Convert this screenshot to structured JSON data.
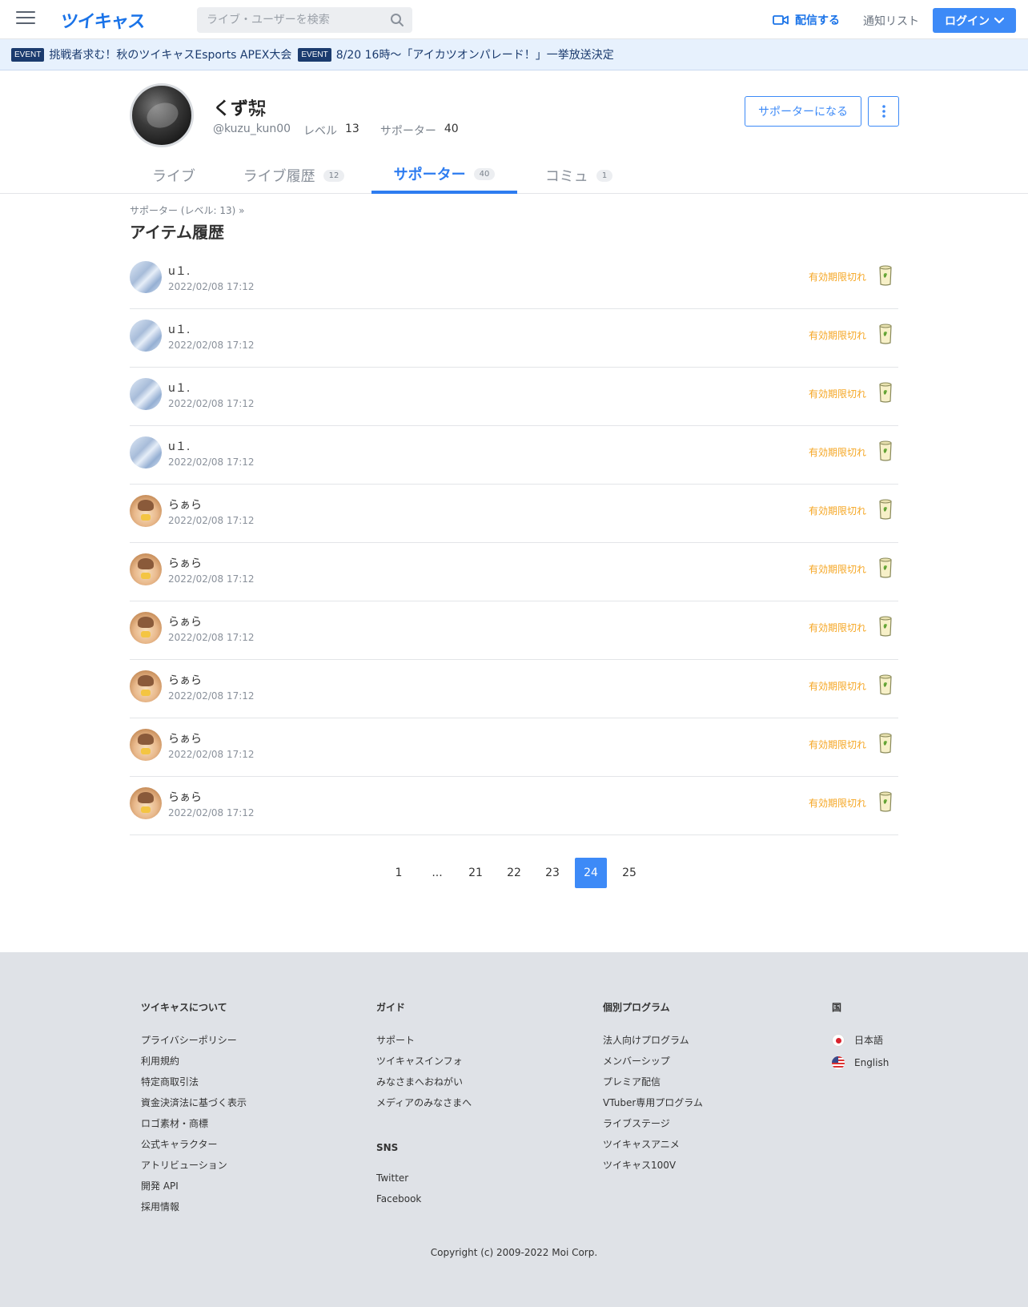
{
  "header": {
    "logo": "ツイキャス",
    "search_placeholder": "ライブ・ユーザーを検索",
    "stream_label": "配信する",
    "notify_label": "通知リスト",
    "login_label": "ログイン"
  },
  "events": [
    {
      "badge": "EVENT",
      "text": "挑戦者求む！秋のツイキャスEsports APEX大会"
    },
    {
      "badge": "EVENT",
      "text": "8/20 16時〜「アイカツオンパレード！」一挙放送決定"
    }
  ],
  "profile": {
    "name": "くず㌗",
    "handle": "@kuzu_kun00",
    "level_label": "レベル",
    "level": "13",
    "supporter_label": "サポーター",
    "supporter_count": "40",
    "supporter_button": "サポーターになる"
  },
  "tabs": [
    {
      "label": "ライブ",
      "count": ""
    },
    {
      "label": "ライブ履歴",
      "count": "12"
    },
    {
      "label": "サポーター",
      "count": "40"
    },
    {
      "label": "コミュ",
      "count": "1"
    }
  ],
  "breadcrumb": "サポーター (レベル: 13)  »",
  "section_title": "アイテム履歴",
  "items": [
    {
      "name": "u１.",
      "date": "2022/02/08 17:12",
      "status": "有効期限切れ",
      "avatar": "u1"
    },
    {
      "name": "u１.",
      "date": "2022/02/08 17:12",
      "status": "有効期限切れ",
      "avatar": "u1"
    },
    {
      "name": "u１.",
      "date": "2022/02/08 17:12",
      "status": "有効期限切れ",
      "avatar": "u1"
    },
    {
      "name": "u１.",
      "date": "2022/02/08 17:12",
      "status": "有効期限切れ",
      "avatar": "u1"
    },
    {
      "name": "らぁら",
      "date": "2022/02/08 17:12",
      "status": "有効期限切れ",
      "avatar": "raara"
    },
    {
      "name": "らぁら",
      "date": "2022/02/08 17:12",
      "status": "有効期限切れ",
      "avatar": "raara"
    },
    {
      "name": "らぁら",
      "date": "2022/02/08 17:12",
      "status": "有効期限切れ",
      "avatar": "raara"
    },
    {
      "name": "らぁら",
      "date": "2022/02/08 17:12",
      "status": "有効期限切れ",
      "avatar": "raara"
    },
    {
      "name": "らぁら",
      "date": "2022/02/08 17:12",
      "status": "有効期限切れ",
      "avatar": "raara"
    },
    {
      "name": "らぁら",
      "date": "2022/02/08 17:12",
      "status": "有効期限切れ",
      "avatar": "raara"
    }
  ],
  "pagination": {
    "pages": [
      "1",
      "...",
      "21",
      "22",
      "23",
      "24",
      "25"
    ],
    "current": "24"
  },
  "footer": {
    "about": {
      "title": "ツイキャスについて",
      "links": [
        "プライバシーポリシー",
        "利用規約",
        "特定商取引法",
        "資金決済法に基づく表示",
        "ロゴ素材・商標",
        "公式キャラクター",
        "アトリビューション",
        "開発 API",
        "採用情報"
      ]
    },
    "guide": {
      "title": "ガイド",
      "links": [
        "サポート",
        "ツイキャスインフォ",
        "みなさまへおねがい",
        "メディアのみなさまへ"
      ]
    },
    "sns": {
      "title": "SNS",
      "links": [
        "Twitter",
        "Facebook"
      ]
    },
    "programs": {
      "title": "個別プログラム",
      "links": [
        "法人向けプログラム",
        "メンバーシップ",
        "プレミア配信",
        "VTuber専用プログラム",
        "ライブステージ",
        "ツイキャスアニメ",
        "ツイキャス100V"
      ]
    },
    "country": {
      "title": "国",
      "langs": [
        "日本語",
        "English"
      ]
    },
    "copyright": "Copyright (c) 2009-2022 Moi Corp."
  },
  "colors": {
    "accent": "#3d8af7",
    "status_expired": "#f5a623",
    "event_badge": "#1b3b6e",
    "footer_bg": "#dfe2e7"
  }
}
